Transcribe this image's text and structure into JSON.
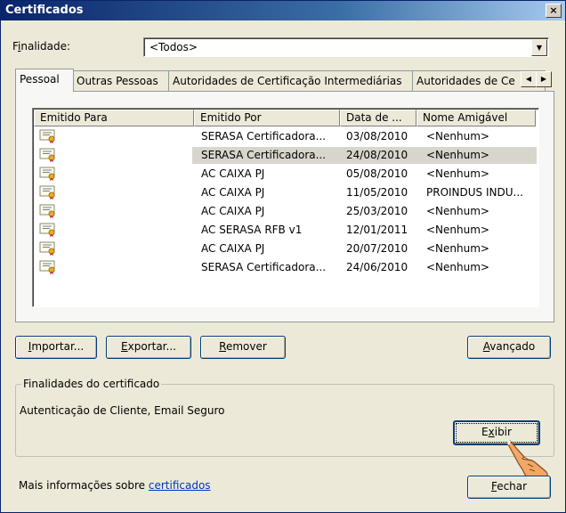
{
  "window": {
    "title": "Certificados",
    "close_glyph": "×"
  },
  "purpose": {
    "label_prefix": "F",
    "label_ul": "i",
    "label_suffix": "nalidade:",
    "value": "<Todos>"
  },
  "tabs": [
    {
      "label": "Pessoal"
    },
    {
      "label": "Outras Pessoas"
    },
    {
      "label": "Autoridades de Certificação Intermediárias"
    },
    {
      "label": "Autoridades de Ce"
    }
  ],
  "table": {
    "columns": [
      "Emitido Para",
      "Emitido Por",
      "Data de ...",
      "Nome Amigável"
    ],
    "rows": [
      {
        "issued_to": "",
        "issued_by": "SERASA Certificadora...",
        "date": "03/08/2010",
        "friendly": "<Nenhum>"
      },
      {
        "issued_to": "",
        "issued_by": "SERASA Certificadora...",
        "date": "24/08/2010",
        "friendly": "<Nenhum>"
      },
      {
        "issued_to": "",
        "issued_by": "AC CAIXA PJ",
        "date": "05/08/2010",
        "friendly": "<Nenhum>"
      },
      {
        "issued_to": "",
        "issued_by": "AC CAIXA PJ",
        "date": "11/05/2010",
        "friendly": "PROINDUS INDU..."
      },
      {
        "issued_to": "",
        "issued_by": "AC CAIXA PJ",
        "date": "25/03/2010",
        "friendly": "<Nenhum>"
      },
      {
        "issued_to": "",
        "issued_by": "AC SERASA RFB v1",
        "date": "12/01/2011",
        "friendly": "<Nenhum>"
      },
      {
        "issued_to": "",
        "issued_by": "AC CAIXA PJ",
        "date": "20/07/2010",
        "friendly": "<Nenhum>"
      },
      {
        "issued_to": "",
        "issued_by": "SERASA Certificadora...",
        "date": "24/06/2010",
        "friendly": "<Nenhum>"
      }
    ]
  },
  "buttons": {
    "import": {
      "ul": "I",
      "rest": "mportar..."
    },
    "export": {
      "ul": "E",
      "rest": "xportar..."
    },
    "remove": {
      "ul": "R",
      "rest": "emover"
    },
    "advanced": {
      "ul": "A",
      "rest": "vançado"
    },
    "view": {
      "pre": "E",
      "ul": "x",
      "rest": "ibir"
    },
    "close": {
      "ul": "F",
      "rest": "echar"
    }
  },
  "purposes_group": {
    "legend": "Finalidades do certificado",
    "text": "Autenticação de Cliente, Email Seguro"
  },
  "footer": {
    "text": "Mais informações sobre ",
    "link": "certificados"
  },
  "colors": {
    "title_bar": "#0a246a",
    "link": "#0033cc",
    "selected_row": "#d8d5cc",
    "face": "#ece9d8"
  }
}
